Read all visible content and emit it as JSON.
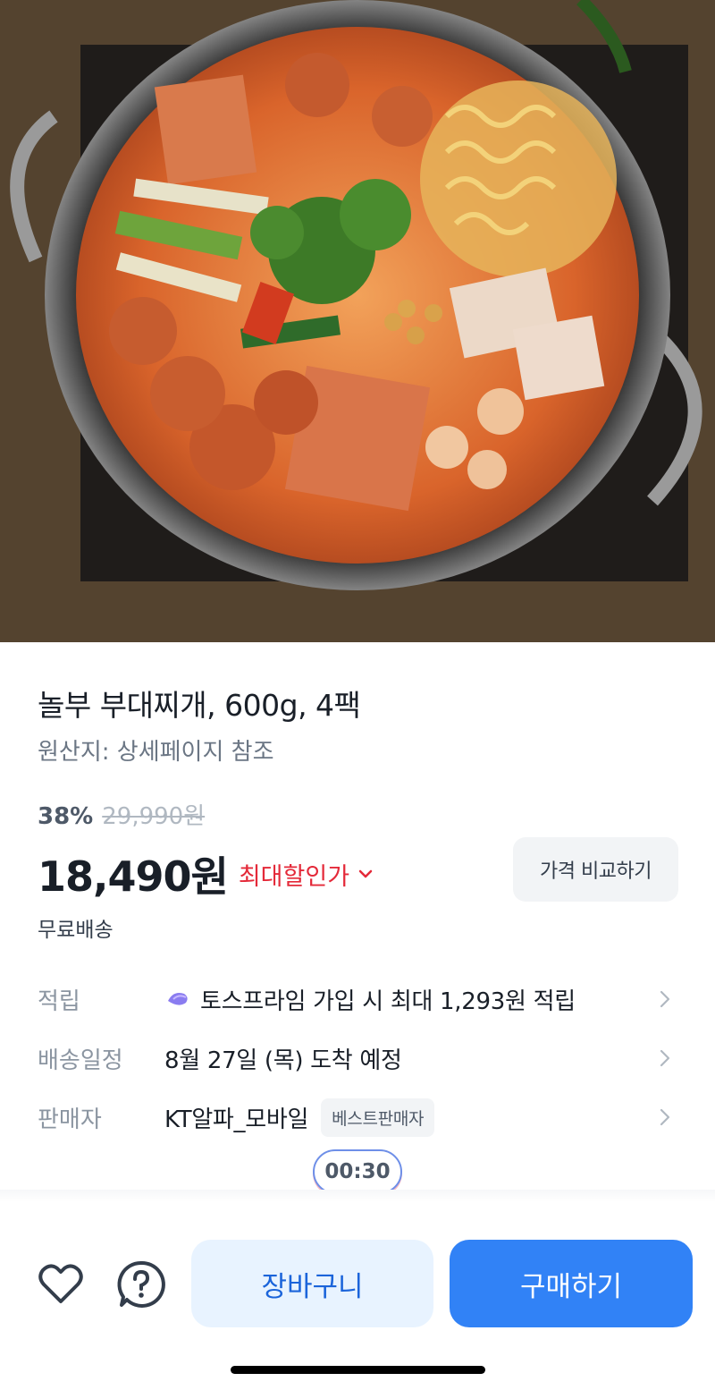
{
  "product": {
    "title": "놀부 부대찌개, 600g, 4팩",
    "origin": "원산지: 상세페이지 참조",
    "discount_rate": "38%",
    "original_price": "29,990원",
    "price": "18,490원",
    "max_discount_label": "최대할인가",
    "compare_button": "가격 비교하기",
    "shipping": "무료배송"
  },
  "details": [
    {
      "label": "적립",
      "value": "토스프라임 가입 시 최대 1,293원 적립"
    },
    {
      "label": "배송일정",
      "value": "8월 27일 (목) 도착 예정"
    },
    {
      "label": "판매자",
      "value": "KT알파_모바일",
      "badge": "베스트판매자"
    }
  ],
  "timer": "00:30",
  "bottom_bar": {
    "cart_label": "장바구니",
    "buy_label": "구매하기"
  },
  "colors": {
    "accent_blue": "#3182f6",
    "discount_red": "#e42939",
    "cart_bg": "#e8f3ff"
  },
  "icons": {
    "wishlist": "heart-icon",
    "help": "question-icon",
    "prime": "toss-prime-icon",
    "chevron": "chevron-right-icon"
  }
}
